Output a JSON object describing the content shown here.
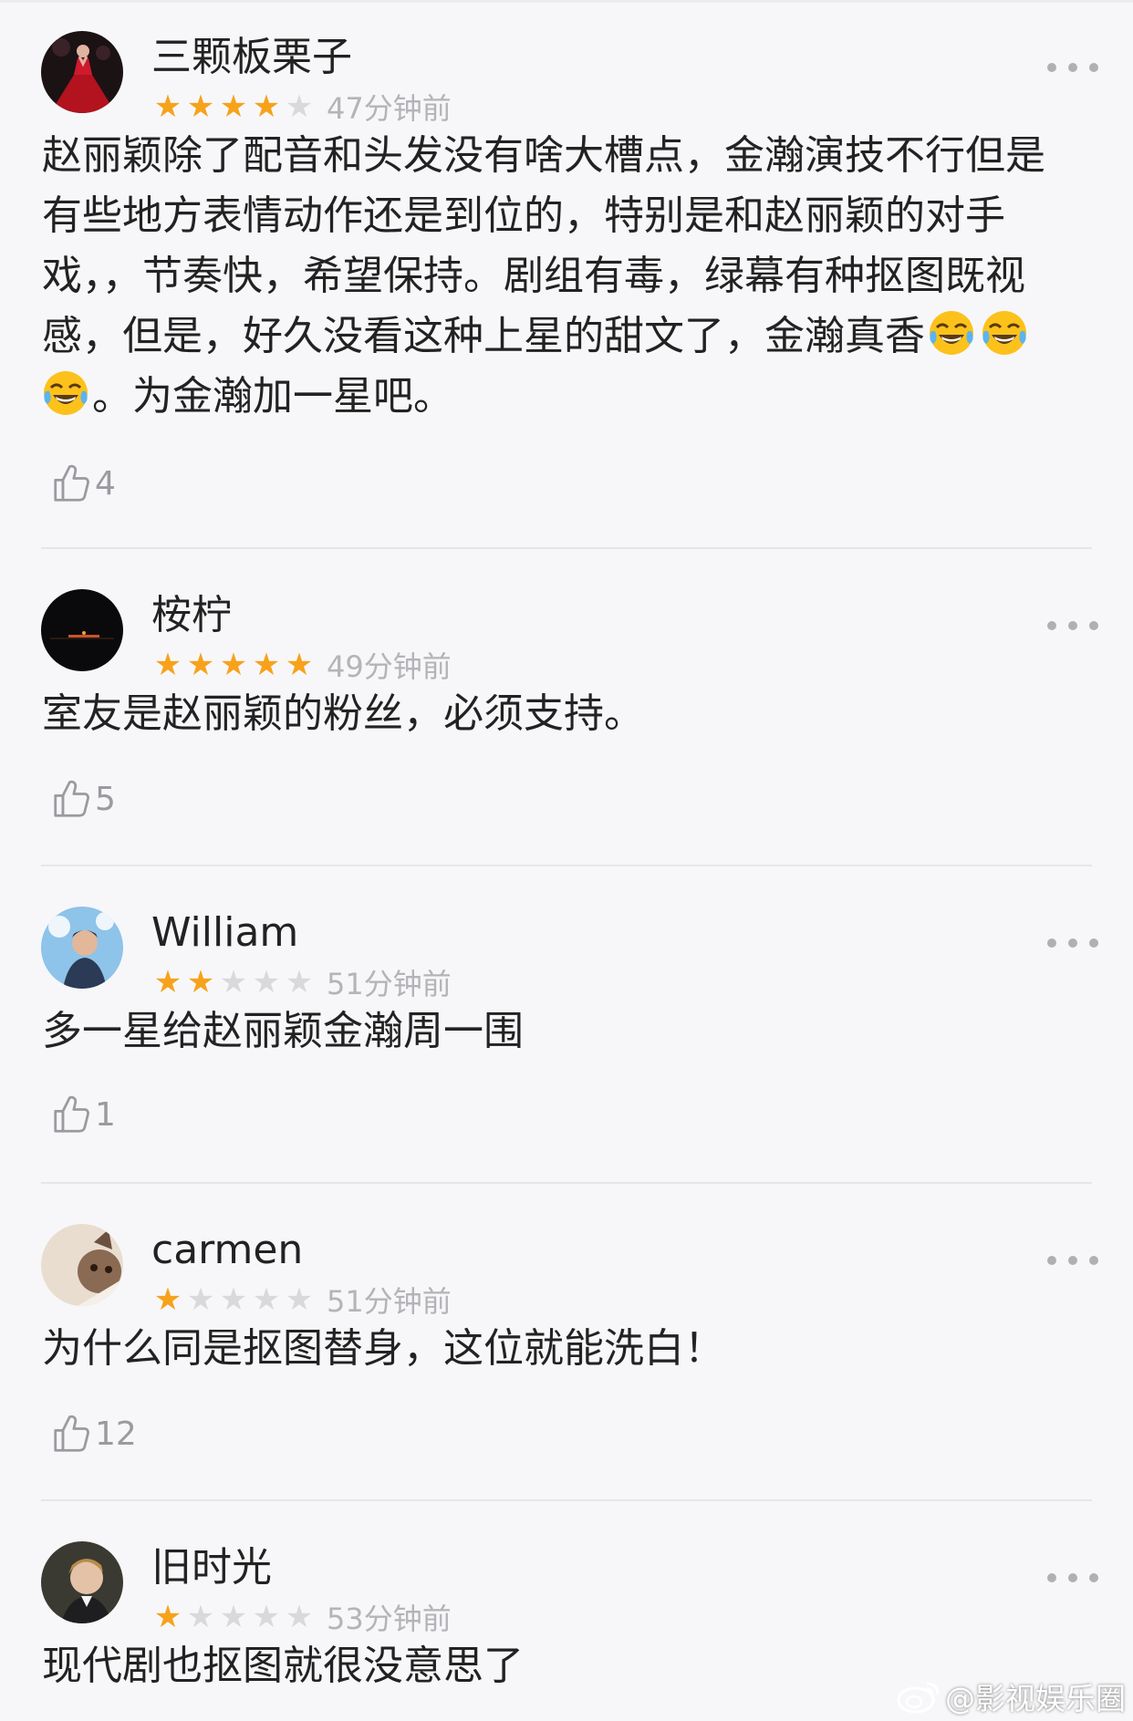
{
  "reviews": [
    {
      "username": "三颗板栗子",
      "rating": 4,
      "time": "47分钟前",
      "content_lines": [
        "赵丽颖除了配音和头发没有啥大槽点，金瀚演技不行但是",
        "有些地方表情动作还是到位的，特别是和赵丽颖的对手",
        "戏，，节奏快，希望保持。剧组有毒，绿幕有种抠图既视",
        "感，但是，好久没看这种上星的甜文了，金瀚真香",
        "。为金瀚加一星吧。"
      ],
      "likes": "4"
    },
    {
      "username": "桉柠",
      "rating": 5,
      "time": "49分钟前",
      "content_lines": [
        "室友是赵丽颖的粉丝，必须支持。"
      ],
      "likes": "5"
    },
    {
      "username": "William",
      "rating": 2,
      "time": "51分钟前",
      "content_lines": [
        "多一星给赵丽颖金瀚周一围"
      ],
      "likes": "1"
    },
    {
      "username": "carmen",
      "rating": 1,
      "time": "51分钟前",
      "content_lines": [
        "为什么同是抠图替身，这位就能洗白！"
      ],
      "likes": "12"
    },
    {
      "username": "旧时光",
      "rating": 1,
      "time": "53分钟前",
      "content_lines": [
        "现代剧也抠图就很没意思了"
      ],
      "likes": null
    }
  ],
  "icons": {
    "star": "star-icon",
    "like": "thumbs-up-icon",
    "more": "more-options-icon",
    "emoji": "tears-of-joy-emoji"
  },
  "colors": {
    "star_active": "#f7a21b",
    "star_inactive": "#d9d9dc",
    "meta_text": "#b4b4b8",
    "background": "#f7f7f9"
  },
  "watermark": "@影视娱乐圈"
}
